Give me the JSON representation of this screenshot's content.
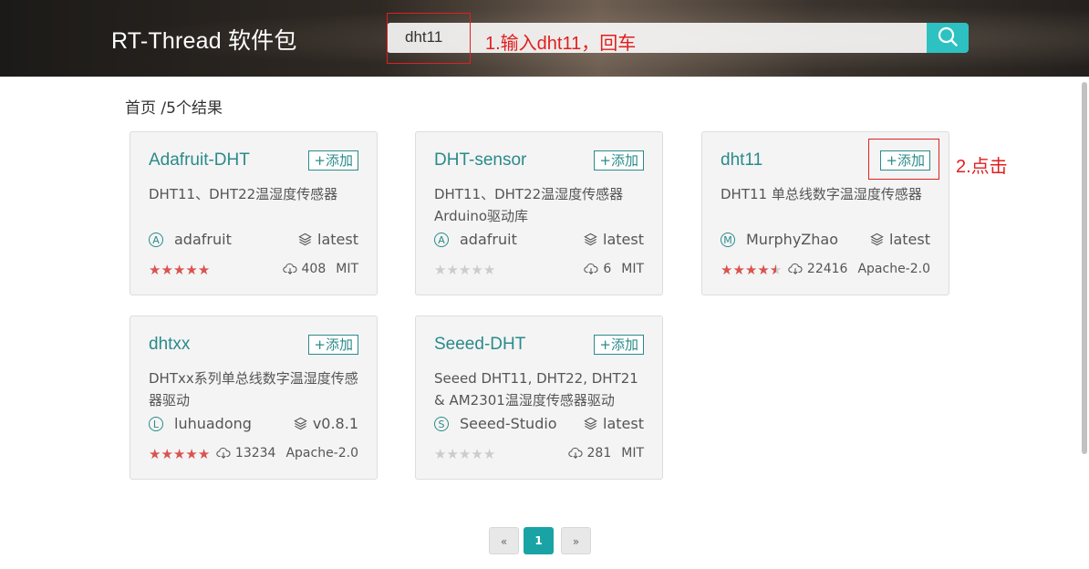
{
  "header": {
    "brand": "RT-Thread 软件包",
    "search_value": "dht11",
    "search_icon": "search-icon"
  },
  "annotations": {
    "step1": "1.输入dht11，回车",
    "step2": "2.点击"
  },
  "breadcrumb": {
    "home": "首页",
    "separator": " /",
    "result_count": "5个结果"
  },
  "add_label": "+添加",
  "packages": [
    {
      "name": "Adafruit-DHT",
      "desc": "DHT11、DHT22温湿度传感器",
      "author_initial": "A",
      "author": "adafruit",
      "version": "latest",
      "stars": 5,
      "downloads": "408",
      "license": "MIT"
    },
    {
      "name": "DHT-sensor",
      "desc": "DHT11、DHT22温湿度传感器Arduino驱动库",
      "author_initial": "A",
      "author": "adafruit",
      "version": "latest",
      "stars": 0,
      "downloads": "6",
      "license": "MIT"
    },
    {
      "name": "dht11",
      "desc": "DHT11 单总线数字温湿度传感器",
      "author_initial": "M",
      "author": "MurphyZhao",
      "version": "latest",
      "stars": 4.5,
      "downloads": "22416",
      "license": "Apache-2.0"
    },
    {
      "name": "dhtxx",
      "desc": "DHTxx系列单总线数字温湿度传感器驱动",
      "author_initial": "L",
      "author": "luhuadong",
      "version": "v0.8.1",
      "stars": 5,
      "downloads": "13234",
      "license": "Apache-2.0"
    },
    {
      "name": "Seeed-DHT",
      "desc": "Seeed DHT11, DHT22, DHT21 & AM2301温湿度传感器驱动",
      "author_initial": "S",
      "author": "Seeed-Studio",
      "version": "latest",
      "stars": 0,
      "downloads": "281",
      "license": "MIT"
    }
  ],
  "pagination": {
    "prev": "«",
    "current": "1",
    "next": "»"
  },
  "colors": {
    "accent": "#2b8a8a",
    "search_button": "#2ec1c2",
    "annotation": "#e02020",
    "star": "#d9534f"
  }
}
